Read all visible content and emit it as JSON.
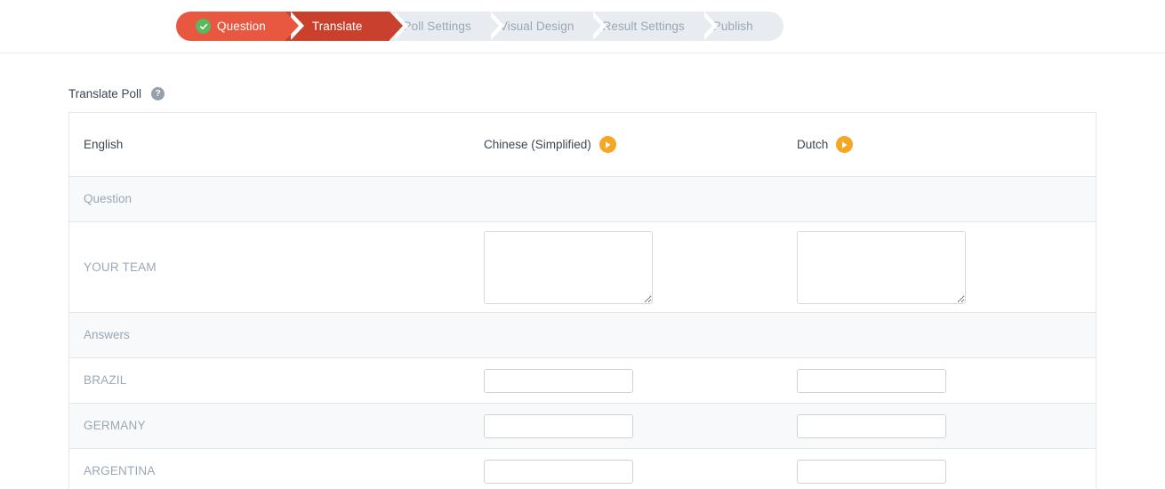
{
  "wizard": {
    "steps": [
      {
        "label": "Question",
        "state": "done",
        "icon": "check-circle-icon"
      },
      {
        "label": "Translate",
        "state": "current",
        "icon": null
      },
      {
        "label": "Poll Settings",
        "state": "upcoming",
        "icon": null
      },
      {
        "label": "Visual Design",
        "state": "upcoming",
        "icon": null
      },
      {
        "label": "Result Settings",
        "state": "upcoming",
        "icon": null
      },
      {
        "label": "Publish",
        "state": "upcoming",
        "icon": null
      }
    ],
    "colors": {
      "done": "#e8573f",
      "current": "#c9402c",
      "upcoming": "#e8ecf0",
      "check": "#5cb85c"
    }
  },
  "page": {
    "title": "Translate Poll",
    "help_icon": "help-circle-icon",
    "help_glyph": "?"
  },
  "table": {
    "columns": [
      {
        "key": "source",
        "label": "English",
        "has_play": false
      },
      {
        "key": "zh",
        "label": "Chinese (Simplified)",
        "has_play": true,
        "play_icon": "play-circle-icon"
      },
      {
        "key": "nl",
        "label": "Dutch",
        "has_play": true,
        "play_icon": "play-circle-icon"
      }
    ],
    "accent_play": "#f5a623",
    "sections": [
      {
        "label": "Question",
        "type": "textarea",
        "rows": [
          {
            "label": "YOUR TEAM",
            "zh_value": "",
            "nl_value": ""
          }
        ]
      },
      {
        "label": "Answers",
        "type": "input",
        "rows": [
          {
            "label": "BRAZIL",
            "zh_value": "",
            "nl_value": ""
          },
          {
            "label": "GERMANY",
            "zh_value": "",
            "nl_value": ""
          },
          {
            "label": "ARGENTINA",
            "zh_value": "",
            "nl_value": ""
          }
        ]
      }
    ]
  }
}
